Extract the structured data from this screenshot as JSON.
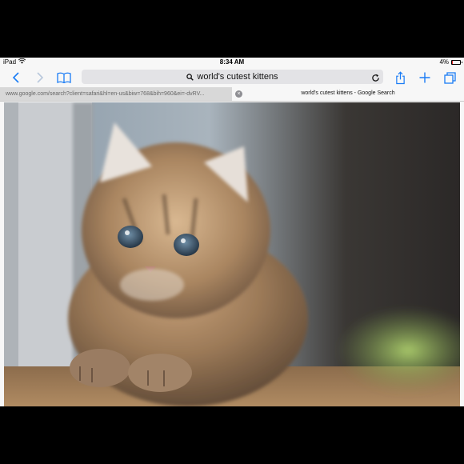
{
  "status_bar": {
    "device": "iPad",
    "time": "8:34 AM",
    "battery": "4%",
    "battery_level": 0.04,
    "battery_color": "#e02020"
  },
  "toolbar": {
    "back_icon": "chevron-left-icon",
    "forward_icon": "chevron-right-icon",
    "bookmarks_icon": "book-icon",
    "address": {
      "search_icon": "search-icon",
      "query": "world's cutest kittens",
      "reload_icon": "reload-icon"
    },
    "share_icon": "share-icon",
    "new_tab_icon": "plus-icon",
    "tabs_icon": "tabs-icon",
    "accent_color": "#1a7cf5"
  },
  "tabs": [
    {
      "title": "www.google.com/search?client=safari&hl=en-us&biw=768&bih=960&ei=-dvRV...",
      "active": false
    },
    {
      "title": "world's cutest kittens - Google Search",
      "active": true,
      "close_icon": "close-icon"
    }
  ],
  "content": {
    "image": "fluffy-kitten-photo"
  }
}
